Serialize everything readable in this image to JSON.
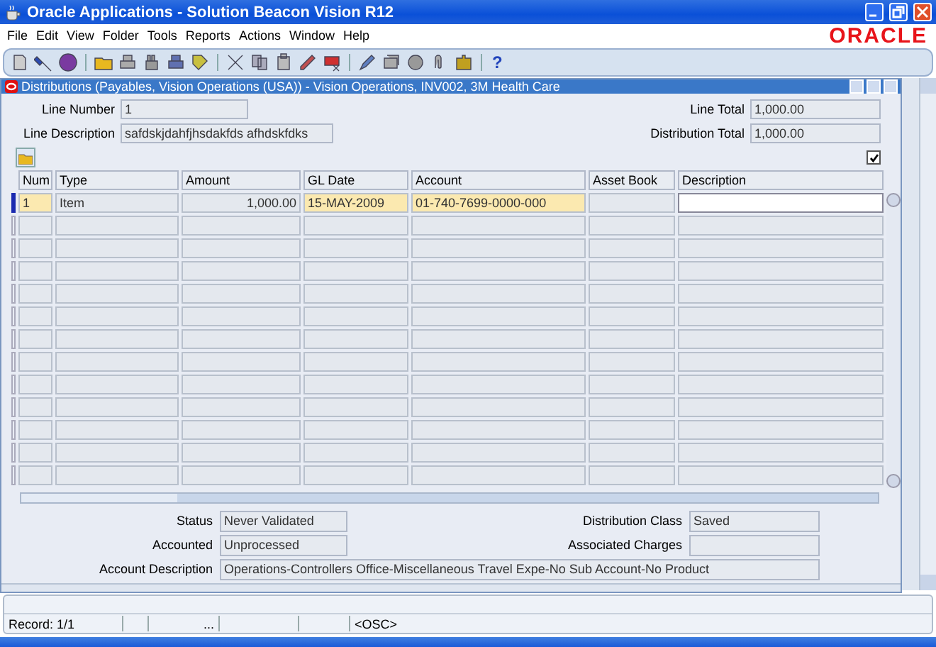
{
  "window": {
    "title": "Oracle Applications - Solution Beacon Vision R12"
  },
  "menu": [
    {
      "label": "File"
    },
    {
      "label": "Edit"
    },
    {
      "label": "View"
    },
    {
      "label": "Folder"
    },
    {
      "label": "Tools"
    },
    {
      "label": "Reports"
    },
    {
      "label": "Actions"
    },
    {
      "label": "Window"
    },
    {
      "label": "Help"
    }
  ],
  "logo": "ORACLE",
  "toolbar": {
    "help": "?"
  },
  "form": {
    "title": "Distributions (Payables, Vision Operations (USA)) - Vision Operations, INV002, 3M Health Care",
    "line_number": {
      "label": "Line Number",
      "value": "1"
    },
    "line_description": {
      "label": "Line Description",
      "value": "safdskjdahfjhsdakfds afhdskfdks"
    },
    "line_total": {
      "label": "Line Total",
      "value": "1,000.00"
    },
    "distribution_total": {
      "label": "Distribution Total",
      "value": "1,000.00"
    },
    "checkbox": {
      "checked": true
    },
    "table": {
      "columns": [
        {
          "label": "Num",
          "required": true,
          "current": false,
          "kind": "text"
        },
        {
          "label": "Type",
          "required": false,
          "current": false,
          "kind": "text"
        },
        {
          "label": "Amount",
          "required": false,
          "current": false,
          "kind": "number"
        },
        {
          "label": "GL Date",
          "required": true,
          "current": false,
          "kind": "text"
        },
        {
          "label": "Account",
          "required": true,
          "current": false,
          "kind": "text"
        },
        {
          "label": "Asset Book",
          "required": false,
          "current": false,
          "kind": "text"
        },
        {
          "label": "Description",
          "required": false,
          "current": true,
          "kind": "text"
        }
      ],
      "rows": [
        {
          "selected": true,
          "cells": [
            "1",
            "Item",
            "1,000.00",
            "15-MAY-2009",
            "01-740-7699-0000-000",
            "",
            ""
          ]
        }
      ]
    },
    "status": {
      "label": "Status",
      "value": "Never Validated"
    },
    "distribution_class": {
      "label": "Distribution Class",
      "value": "Saved"
    },
    "accounted": {
      "label": "Accounted",
      "value": "Unprocessed"
    },
    "associated_charges": {
      "label": "Associated Charges"
    },
    "account_description": {
      "label": "Account Description",
      "value": "Operations-Controllers Office-Miscellaneous Travel Expe-No Sub Account-No Product"
    }
  },
  "status_bar": {
    "record": "Record: 1/1",
    "field_3": "...",
    "mode": "<OSC>"
  }
}
